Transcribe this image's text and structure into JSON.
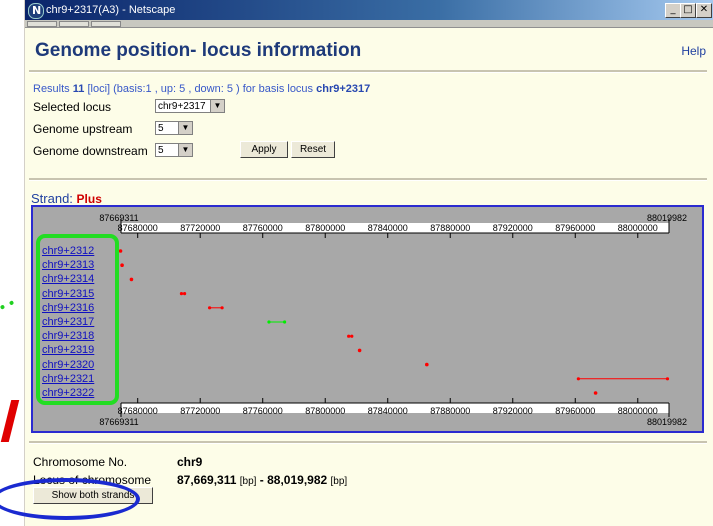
{
  "window": {
    "title": "chr9+2317(A3) - Netscape",
    "min": "_",
    "max": "□",
    "close": "✕"
  },
  "page": {
    "heading": "Genome position- locus information",
    "help": "Help",
    "results": {
      "prefix": "Results ",
      "count": "11",
      "mid": " [loci] (basis:1 , up: 5 , down: 5 ) for basis locus ",
      "basis": "chr9+2317"
    },
    "form": {
      "selected_label": "Selected locus",
      "selected_value": "chr9+2317",
      "upstream_label": "Genome upstream",
      "upstream_value": "5",
      "downstream_label": "Genome downstream",
      "downstream_value": "5",
      "apply": "Apply",
      "reset": "Reset"
    },
    "strand_label": "Strand: ",
    "strand_value": "Plus",
    "info": {
      "chrom_label": "Chromosome No.",
      "chrom_value": "chr9",
      "locus_label": "Locus of chromosome",
      "locus_start": "87,669,311",
      "locus_end": "88,019,982",
      "unit": "[bp]",
      "sep": " - ",
      "show_both": "Show both strands"
    }
  },
  "chart_data": {
    "type": "scatter",
    "x_range": [
      87669311,
      88019982
    ],
    "range_start_label": "87669311",
    "range_end_label": "88019982",
    "ticks": [
      "87680000",
      "87720000",
      "87760000",
      "87800000",
      "87840000",
      "87880000",
      "87920000",
      "87960000",
      "88000000"
    ],
    "tick_values": [
      87680000,
      87720000,
      87760000,
      87800000,
      87840000,
      87880000,
      87920000,
      87960000,
      88000000
    ],
    "loci": [
      {
        "name": "chr9+2312",
        "start": 87669000,
        "end": 87669000,
        "color": "#ff0000"
      },
      {
        "name": "chr9+2313",
        "start": 87670000,
        "end": 87670000,
        "color": "#ff0000"
      },
      {
        "name": "chr9+2314",
        "start": 87676000,
        "end": 87676000,
        "color": "#ff0000"
      },
      {
        "name": "chr9+2315",
        "start": 87708000,
        "end": 87710000,
        "color": "#ff0000"
      },
      {
        "name": "chr9+2316",
        "start": 87726000,
        "end": 87734000,
        "color": "#ff0000"
      },
      {
        "name": "chr9+2317",
        "start": 87764000,
        "end": 87774000,
        "color": "#00ee00"
      },
      {
        "name": "chr9+2318",
        "start": 87815000,
        "end": 87817000,
        "color": "#ff0000"
      },
      {
        "name": "chr9+2319",
        "start": 87822000,
        "end": 87822000,
        "color": "#ff0000"
      },
      {
        "name": "chr9+2320",
        "start": 87865000,
        "end": 87865000,
        "color": "#ff0000"
      },
      {
        "name": "chr9+2321",
        "start": 87962000,
        "end": 88019000,
        "color": "#ff0000"
      },
      {
        "name": "chr9+2322",
        "start": 87973000,
        "end": 87973000,
        "color": "#ff0000"
      }
    ]
  }
}
